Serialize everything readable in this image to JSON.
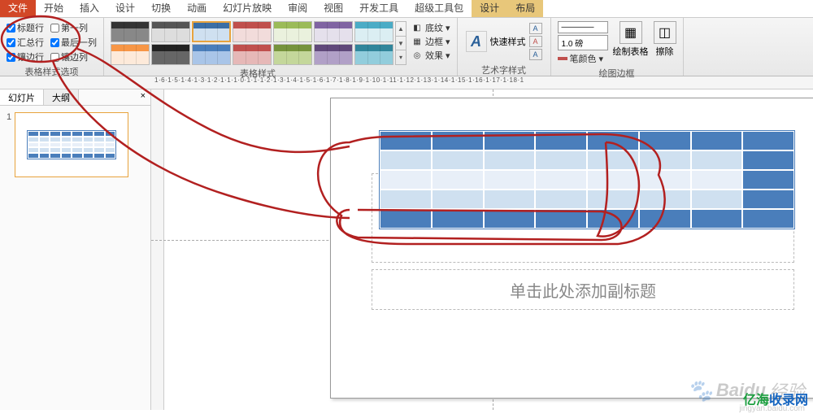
{
  "tabs": {
    "file": "文件",
    "items": [
      "开始",
      "插入",
      "设计",
      "切换",
      "动画",
      "幻灯片放映",
      "审阅",
      "视图",
      "开发工具",
      "超级工具包"
    ],
    "context": [
      "设计",
      "布局"
    ]
  },
  "ribbon": {
    "options": {
      "header_row": "标题行",
      "first_col": "第一列",
      "total_row": "汇总行",
      "last_col": "最后一列",
      "banded_row": "镶边行",
      "banded_col": "镶边列",
      "group_label": "表格样式选项"
    },
    "styles_group_label": "表格样式",
    "shading": {
      "shading": "底纹",
      "border": "边框",
      "effects": "效果"
    },
    "wordart": {
      "quick": "快速样式",
      "group_label": "艺术字样式",
      "letter": "A"
    },
    "draw": {
      "pen_style_placeholder": "————",
      "pen_weight": "1.0 磅",
      "pen_color": "笔颜色",
      "draw_table": "绘制表格",
      "eraser": "擦除",
      "group_label": "绘图边框"
    }
  },
  "ruler_text": "1·6·1·5·1·4·1·3·1·2·1·1·1·0·1·1·1·2·1·3·1·4·1·5·1·6·1·7·1·8·1·9·1·10·1·11·1·12·1·13·1·14·1·15·1·16·1·17·1·18·1",
  "sidebar": {
    "tab_slides": "幻灯片",
    "tab_outline": "大纲",
    "close": "×",
    "slide_num": "1"
  },
  "slide": {
    "subtitle_placeholder": "单击此处添加副标题"
  },
  "watermark": {
    "text": "经验",
    "brand": "Baidu",
    "url": "jingyan.baidu.com",
    "site1": "亿海",
    "site2": "收录网"
  }
}
